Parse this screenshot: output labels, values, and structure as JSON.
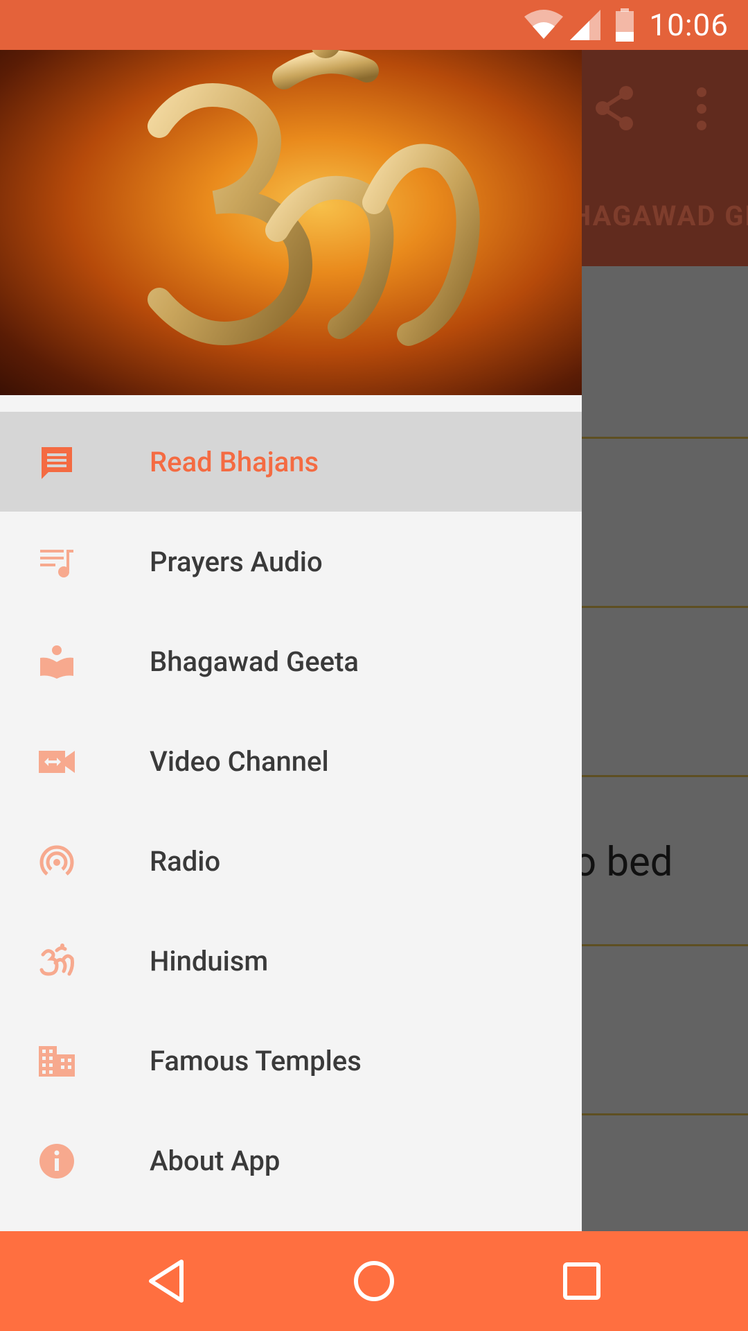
{
  "status_bar": {
    "time": "10:06",
    "bg_color": "#E4623A"
  },
  "background_app": {
    "tab_label": "HAGAWAD GE",
    "content_text": "o bed",
    "app_bar_color": "#612B1E"
  },
  "drawer": {
    "header_image": "om-symbol-image",
    "items": [
      {
        "label": "Read Bhajans",
        "icon": "chat-message-icon",
        "active": true
      },
      {
        "label": "Prayers Audio",
        "icon": "queue-music-icon",
        "active": false
      },
      {
        "label": "Bhagawad Geeta",
        "icon": "book-reader-icon",
        "active": false
      },
      {
        "label": "Video Channel",
        "icon": "video-camera-icon",
        "active": false
      },
      {
        "label": "Radio",
        "icon": "radio-waves-icon",
        "active": false
      },
      {
        "label": "Hinduism",
        "icon": "om-icon",
        "active": false
      },
      {
        "label": "Famous Temples",
        "icon": "building-icon",
        "active": false
      },
      {
        "label": "About App",
        "icon": "info-icon",
        "active": false
      }
    ],
    "accent_color": "#F46B42",
    "icon_color": "#F7A98E"
  },
  "nav_bar": {
    "bg_color": "#FF6F40",
    "buttons": [
      "back",
      "home",
      "recents"
    ]
  }
}
